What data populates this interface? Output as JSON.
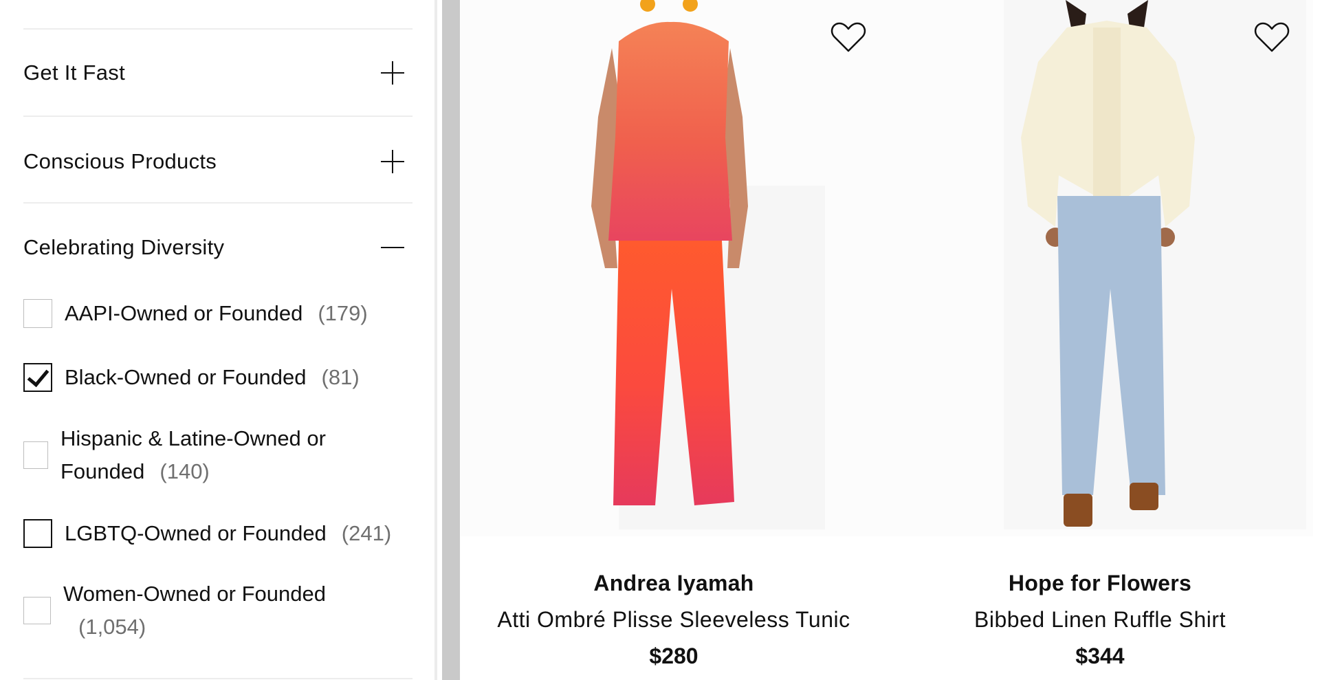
{
  "sidebar": {
    "facets": [
      {
        "label": "Get It Fast",
        "state": "collapsed"
      },
      {
        "label": "Conscious Products",
        "state": "collapsed"
      },
      {
        "label": "Celebrating Diversity",
        "state": "expanded"
      }
    ],
    "diversity_options": [
      {
        "label": "AAPI-Owned or Founded",
        "count": "(179)",
        "checked": false
      },
      {
        "label": "Black-Owned or Founded",
        "count": "(81)",
        "checked": true
      },
      {
        "label": "Hispanic & Latine-Owned or",
        "label_line2": "Founded",
        "count": "(140)",
        "checked": false
      },
      {
        "label": "LGBTQ-Owned or Founded",
        "count": "(241)",
        "checked": false
      },
      {
        "label": "Women-Owned or Founded",
        "count": "(1,054)",
        "checked": false
      }
    ]
  },
  "products": [
    {
      "brand": "Andrea Iyamah",
      "name": "Atti Ombré Plisse Sleeveless Tunic",
      "price": "$280",
      "image_icon": "model-ombre-tunic-set-image",
      "favorited": false
    },
    {
      "brand": "Hope for Flowers",
      "name": "Bibbed Linen Ruffle Shirt",
      "price": "$344",
      "image_icon": "model-linen-ruffle-shirt-image",
      "favorited": false
    }
  ],
  "colors": {
    "ombre_top": "#f47a4f",
    "ombre_mid": "#e8455f",
    "ombre_bottom": "#ff5a2e",
    "divider": "#c9c9c9"
  }
}
